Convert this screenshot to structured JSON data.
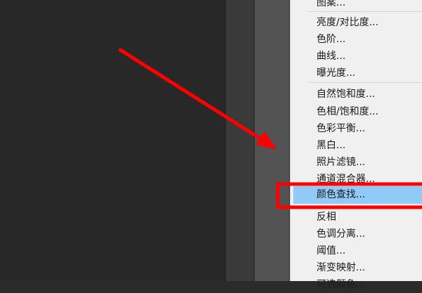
{
  "menu": {
    "items": [
      "图案...",
      "亮度/对比度...",
      "色阶...",
      "曲线...",
      "曝光度...",
      "自然饱和度...",
      "色相/饱和度...",
      "色彩平衡...",
      "黑白...",
      "照片滤镜...",
      "通道混合器...",
      "颜色查找...",
      "反相",
      "色调分离...",
      "阈值...",
      "渐变映射...",
      "可选颜色..."
    ],
    "highlighted_item": "颜色查找..."
  },
  "colors": {
    "annotation": "#ff0000",
    "highlight": "#91c9f7",
    "canvas": "#282828",
    "menu_background": "#f0f0f0"
  }
}
